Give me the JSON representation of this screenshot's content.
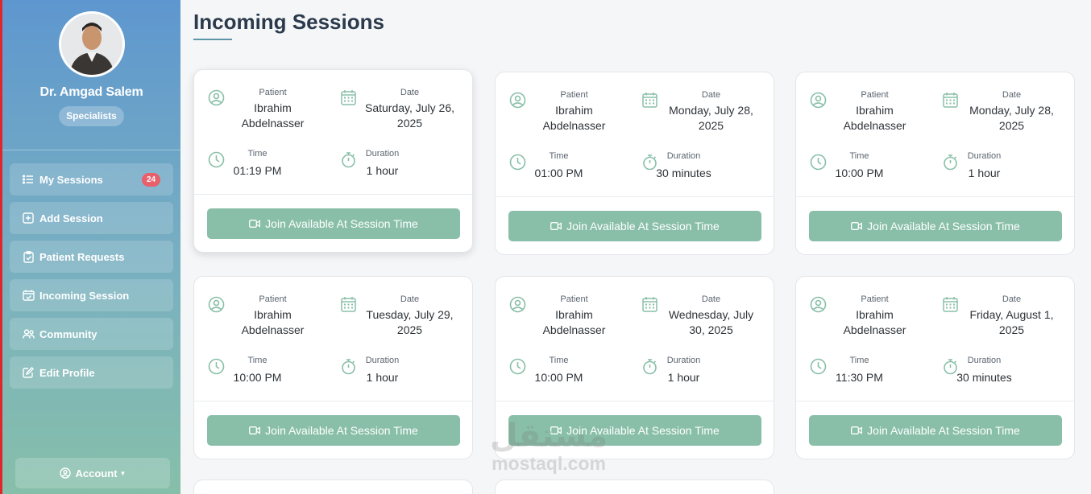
{
  "sidebar": {
    "profile_name": "Dr. Amgad Salem",
    "role": "Specialists",
    "items": [
      {
        "label": "My Sessions",
        "icon": "list-icon",
        "badge": "24"
      },
      {
        "label": "Add Session",
        "icon": "plus-square-icon"
      },
      {
        "label": "Patient Requests",
        "icon": "clipboard-check-icon"
      },
      {
        "label": "Incoming Session",
        "icon": "calendar-check-icon"
      },
      {
        "label": "Community",
        "icon": "people-icon"
      },
      {
        "label": "Edit Profile",
        "icon": "pencil-square-icon"
      }
    ],
    "account_label": "Account"
  },
  "main": {
    "title": "Incoming Sessions",
    "labels": {
      "patient": "Patient",
      "date": "Date",
      "time": "Time",
      "duration": "Duration"
    },
    "join_label": "Join Available At Session Time",
    "sessions": [
      {
        "patient_first": "Ibrahim",
        "patient_last": "Abdelnasser",
        "date_line1": "Saturday, July 26,",
        "date_line2": "2025",
        "time": "01:19 PM",
        "duration": "1 hour"
      },
      {
        "patient_first": "Ibrahim",
        "patient_last": "Abdelnasser",
        "date_line1": "Monday, July 28,",
        "date_line2": "2025",
        "time": "01:00 PM",
        "duration": "30 minutes"
      },
      {
        "patient_first": "Ibrahim",
        "patient_last": "Abdelnasser",
        "date_line1": "Monday, July 28,",
        "date_line2": "2025",
        "time": "10:00 PM",
        "duration": "1 hour"
      },
      {
        "patient_first": "Ibrahim",
        "patient_last": "Abdelnasser",
        "date_line1": "Tuesday, July 29,",
        "date_line2": "2025",
        "time": "10:00 PM",
        "duration": "1 hour"
      },
      {
        "patient_first": "Ibrahim",
        "patient_last": "Abdelnasser",
        "date_line1": "Wednesday, July",
        "date_line2": "30, 2025",
        "time": "10:00 PM",
        "duration": "1 hour"
      },
      {
        "patient_first": "Ibrahim",
        "patient_last": "Abdelnasser",
        "date_line1": "Friday, August 1,",
        "date_line2": "2025",
        "time": "11:30 PM",
        "duration": "30 minutes"
      }
    ]
  },
  "watermark": {
    "arabic": "مستقل",
    "latin": "mostaql.com"
  },
  "colors": {
    "accent_button": "#89bfa9",
    "badge": "#e95f6a",
    "title": "#2b3a4c",
    "icon": "#89bfa9"
  }
}
